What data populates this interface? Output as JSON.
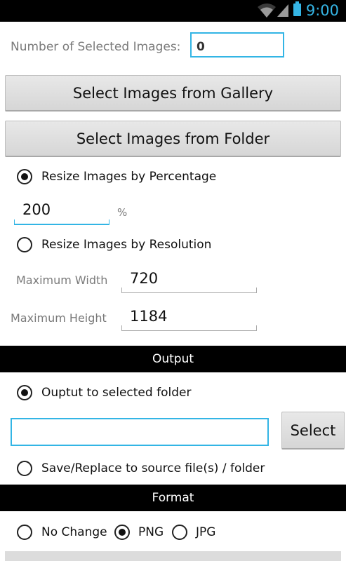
{
  "status_bar": {
    "time": "9:00"
  },
  "selection": {
    "label": "Number of Selected Images:",
    "count": "0"
  },
  "buttons": {
    "gallery": "Select Images from Gallery",
    "folder": "Select Images from Folder",
    "select": "Select"
  },
  "resize": {
    "by_percentage": {
      "label": "Resize Images by Percentage",
      "selected": true,
      "value": "200",
      "unit": "%"
    },
    "by_resolution": {
      "label": "Resize Images by Resolution",
      "selected": false,
      "max_width_label": "Maximum Width",
      "max_width": "720",
      "max_height_label": "Maximum Height",
      "max_height": "1184"
    }
  },
  "output": {
    "header": "Output",
    "to_folder": {
      "label": "Ouptut to selected folder",
      "selected": true,
      "folder_value": ""
    },
    "replace": {
      "label": "Save/Replace to source file(s) / folder",
      "selected": false
    }
  },
  "format": {
    "header": "Format",
    "options": [
      {
        "label": "No Change",
        "selected": false
      },
      {
        "label": "PNG",
        "selected": true
      },
      {
        "label": "JPG",
        "selected": false
      }
    ]
  },
  "colors": {
    "accent": "#33b5e5",
    "status_icons": "#35b5e5"
  },
  "icons": [
    "wifi-icon",
    "signal-icon",
    "battery-icon"
  ]
}
